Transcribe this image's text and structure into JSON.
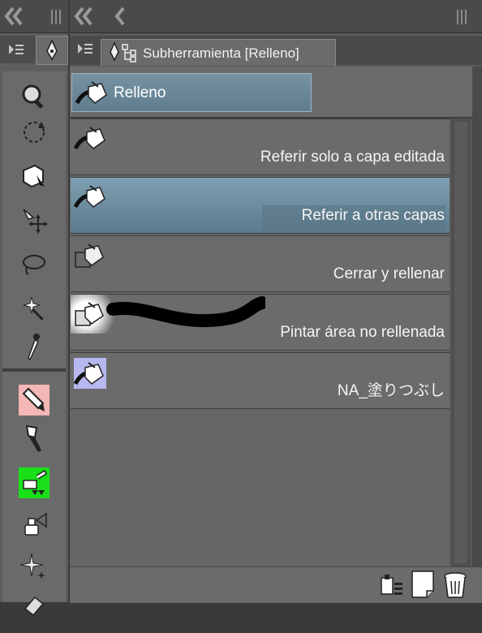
{
  "left_panel": {
    "collapse_icon": "double-chevron-left-icon",
    "grip_icon": "grip-icon",
    "tabs": [
      {
        "icon": "menu-icon"
      },
      {
        "icon": "pen-nib-icon"
      }
    ],
    "tools": [
      {
        "icon": "zoom-icon"
      },
      {
        "icon": "rotate-icon"
      },
      {
        "icon": "object-select-icon"
      },
      {
        "icon": "move-icon"
      },
      {
        "icon": "lasso-icon"
      },
      {
        "icon": "magic-wand-icon"
      },
      {
        "icon": "eyedropper-icon"
      },
      {
        "icon": "pen-icon",
        "highlight": "#f4b6b6"
      },
      {
        "icon": "brush-icon"
      },
      {
        "icon": "airbrush-icon",
        "highlight": "#19e019"
      },
      {
        "icon": "spray-icon"
      },
      {
        "icon": "sparkle-icon"
      },
      {
        "icon": "eraser-icon"
      }
    ]
  },
  "main_panel": {
    "collapse_icon": "double-chevron-left-icon",
    "back_icon": "chevron-left-icon",
    "grip_icon": "grip-icon",
    "tab_title": "Subherramienta [Relleno]",
    "group": {
      "label": "Relleno",
      "color": "#6e8d9e"
    },
    "items": [
      {
        "label": "Referir solo a capa editada",
        "selected": false
      },
      {
        "label": "Referir a otras capas",
        "selected": true
      },
      {
        "label": "Cerrar y rellenar",
        "selected": false
      },
      {
        "label": "Pintar área no rellenada",
        "selected": false
      },
      {
        "label": "NA_塗りつぶし",
        "selected": false
      }
    ],
    "bottom_icons": [
      "subtool-settings-icon",
      "new-subtool-icon",
      "trash-icon"
    ]
  }
}
